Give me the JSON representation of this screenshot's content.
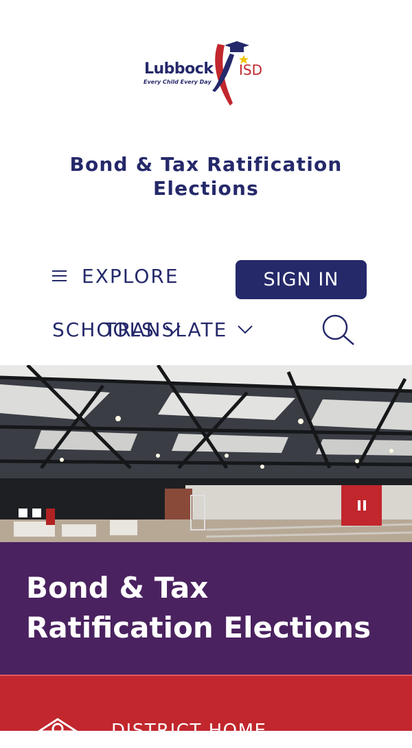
{
  "logo": {
    "brand": "Lubbock",
    "suffix": "ISD",
    "tagline": "Every Child Every Day"
  },
  "page_title": "Bond & Tax Ratification Elections",
  "nav": {
    "explore_label": "EXPLORE",
    "sign_in_label": "SIGN IN",
    "schools_label": "SCHOOLS",
    "translate_label": "TRANSLATE"
  },
  "icons": {
    "menu": "hamburger-icon",
    "chevron": "chevron-down-icon",
    "search": "search-icon",
    "pause": "pause-icon",
    "district": "school-building-icon"
  },
  "slider": {
    "slide_count": 3,
    "active_index": 2
  },
  "banner": {
    "heading": "Bond & Tax Ratification Elections"
  },
  "quick_links": {
    "district_home_label": "DISTRICT HOME"
  },
  "colors": {
    "navy": "#25296a",
    "purple": "#4a2260",
    "red": "#c1272d",
    "white": "#ffffff"
  }
}
